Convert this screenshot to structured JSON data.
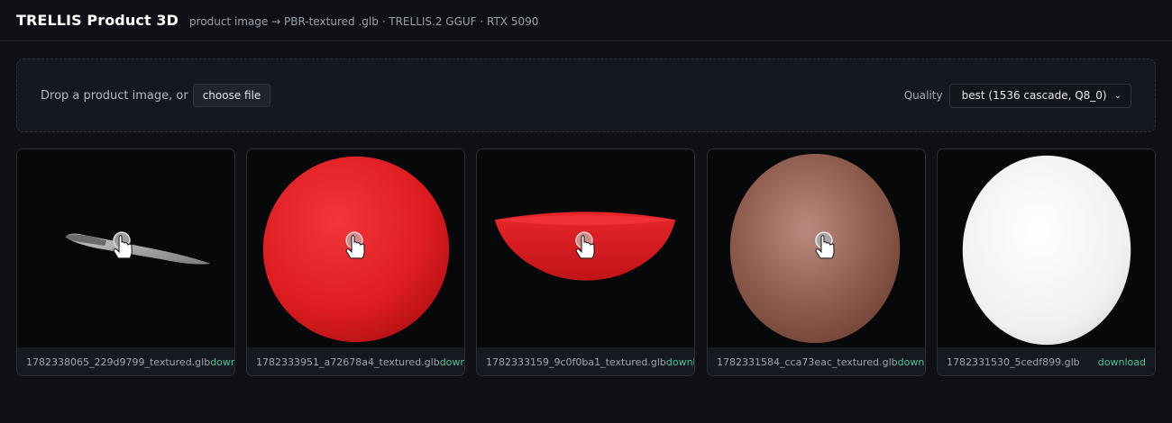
{
  "header": {
    "title": "TRELLIS Product 3D",
    "subtitle": "product image → PBR-textured .glb · TRELLIS.2 GGUF · RTX 5090"
  },
  "dropzone": {
    "prompt": "Drop a product image, or",
    "choose_label": "choose file"
  },
  "quality": {
    "label": "Quality",
    "selected": "best (1536 cascade, Q8_0)"
  },
  "models": [
    {
      "filename": "1782338065_229d9799_textured.glb",
      "download": "download",
      "object": "knife"
    },
    {
      "filename": "1782333951_a72678a4_textured.glb",
      "download": "download",
      "object": "red-sphere"
    },
    {
      "filename": "1782333159_9c0f0ba1_textured.glb",
      "download": "download",
      "object": "red-bowl"
    },
    {
      "filename": "1782331584_cca73eac_textured.glb",
      "download": "download",
      "object": "brown-sphere"
    },
    {
      "filename": "1782331530_5cedf899.glb",
      "download": "download",
      "object": "white-ellipsoid"
    }
  ],
  "colors": {
    "accent_download": "#4fc39b",
    "background": "#0e1016"
  }
}
